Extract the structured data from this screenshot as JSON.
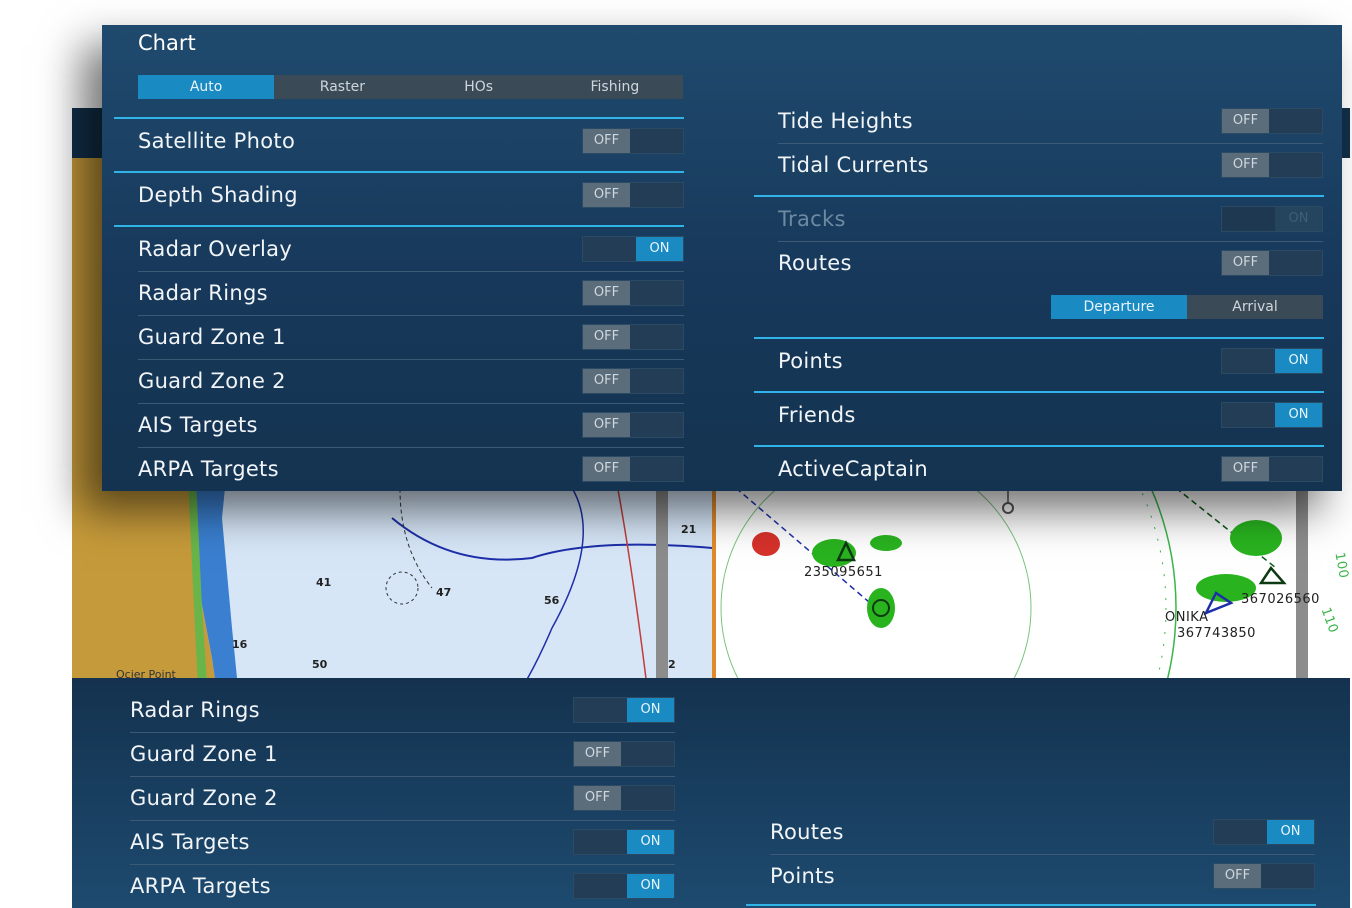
{
  "map": {
    "depth_labels": [
      "21",
      "41",
      "47",
      "56",
      "16",
      "50",
      "2"
    ],
    "place_label": "Ocier Point",
    "radar_targets": [
      "235095651",
      "ONIKA",
      "367743850",
      "367026560"
    ],
    "radar_range_labels": [
      "100",
      "110"
    ]
  },
  "top_panel": {
    "chart_section": {
      "title": "Chart",
      "chart_types": [
        {
          "label": "Auto",
          "active": true
        },
        {
          "label": "Raster",
          "active": false
        },
        {
          "label": "HOs",
          "active": false
        },
        {
          "label": "Fishing",
          "active": false
        }
      ]
    },
    "left_rows": [
      {
        "label": "Satellite Photo",
        "state": "OFF"
      },
      {
        "label": "Depth Shading",
        "state": "OFF"
      },
      {
        "label": "Radar Overlay",
        "state": "ON"
      },
      {
        "label": "Radar Rings",
        "state": "OFF"
      },
      {
        "label": "Guard Zone 1",
        "state": "OFF"
      },
      {
        "label": "Guard Zone 2",
        "state": "OFF"
      },
      {
        "label": "AIS Targets",
        "state": "OFF"
      },
      {
        "label": "ARPA Targets",
        "state": "OFF"
      }
    ],
    "right_rows": [
      {
        "label": "Tide Heights",
        "state": "OFF"
      },
      {
        "label": "Tidal Currents",
        "state": "OFF"
      },
      {
        "label": "Tracks",
        "state": "ON",
        "disabled": true
      },
      {
        "label": "Routes",
        "state": "OFF"
      },
      {
        "label": "Points",
        "state": "ON"
      },
      {
        "label": "Friends",
        "state": "ON"
      },
      {
        "label": "ActiveCaptain",
        "state": "OFF"
      }
    ],
    "route_modes": [
      {
        "label": "Departure",
        "active": true
      },
      {
        "label": "Arrival",
        "active": false
      }
    ]
  },
  "bottom_panel": {
    "left_rows": [
      {
        "label": "Radar Rings",
        "state": "ON"
      },
      {
        "label": "Guard Zone 1",
        "state": "OFF"
      },
      {
        "label": "Guard Zone 2",
        "state": "OFF"
      },
      {
        "label": "AIS Targets",
        "state": "ON"
      },
      {
        "label": "ARPA Targets",
        "state": "ON"
      }
    ],
    "right_rows": [
      {
        "label": "Routes",
        "state": "ON"
      },
      {
        "label": "Points",
        "state": "OFF"
      }
    ]
  }
}
